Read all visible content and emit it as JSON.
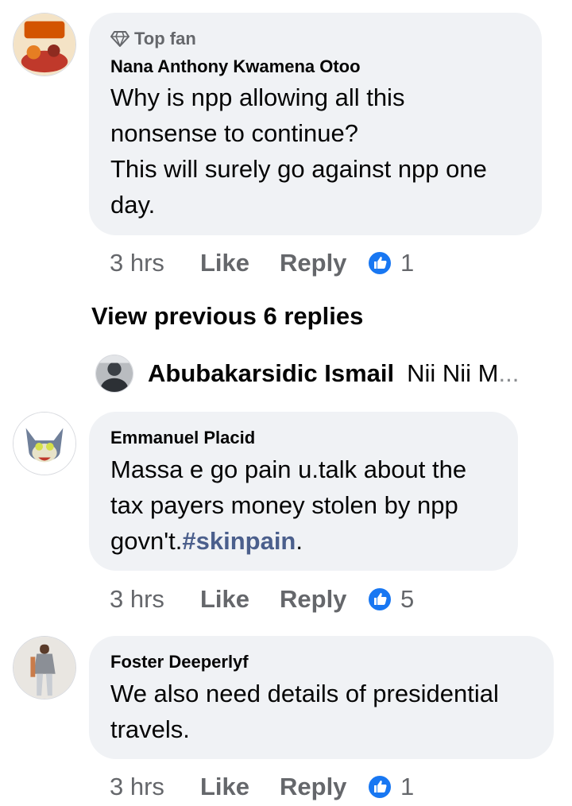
{
  "comments": [
    {
      "badge": "Top fan",
      "author": "Nana Anthony Kwamena Otoo",
      "lines": [
        "Why is npp allowing all this",
        "nonsense to continue?",
        "This will surely go against npp one",
        "day."
      ],
      "time": "3 hrs",
      "like_label": "Like",
      "reply_label": "Reply",
      "reaction_count": "1"
    },
    {
      "author": "Emmanuel Placid",
      "lines": [
        "Massa e go pain u.talk about the",
        "tax payers money stolen by npp",
        "govn't."
      ],
      "hashtag": "#skinpain",
      "trail": ".",
      "time": "3 hrs",
      "like_label": "Like",
      "reply_label": "Reply",
      "reaction_count": "5"
    },
    {
      "author": "Foster Deeperlyf",
      "lines": [
        "We also need details of presidential",
        "travels."
      ],
      "time": "3 hrs",
      "like_label": "Like",
      "reply_label": "Reply",
      "reaction_count": "1"
    }
  ],
  "view_previous": "View previous 6 replies",
  "reply_preview": {
    "author": "Abubakarsidic Ismail",
    "text": "Nii Nii M",
    "ellipsis": "..."
  },
  "colors": {
    "bubble": "#f0f2f5",
    "like_blue": "#1877f2",
    "secondary_text": "#65676b",
    "hashtag": "#4b5f8c"
  }
}
